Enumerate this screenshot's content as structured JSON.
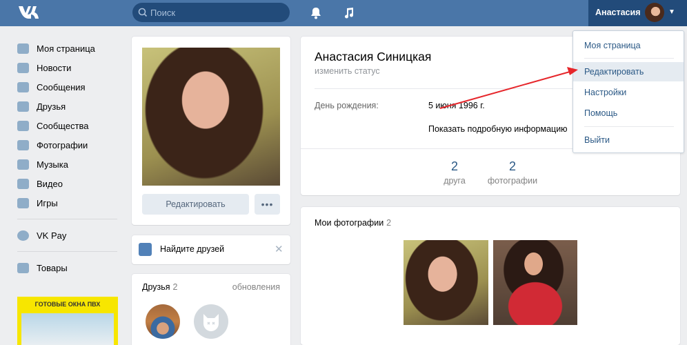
{
  "header": {
    "search_placeholder": "Поиск",
    "profile_name": "Анастасия"
  },
  "sidebar": {
    "items": [
      {
        "label": "Моя страница",
        "icon": "home-icon"
      },
      {
        "label": "Новости",
        "icon": "news-icon"
      },
      {
        "label": "Сообщения",
        "icon": "messages-icon"
      },
      {
        "label": "Друзья",
        "icon": "friends-icon"
      },
      {
        "label": "Сообщества",
        "icon": "groups-icon"
      },
      {
        "label": "Фотографии",
        "icon": "camera-icon"
      },
      {
        "label": "Музыка",
        "icon": "music-icon"
      },
      {
        "label": "Видео",
        "icon": "video-icon"
      },
      {
        "label": "Игры",
        "icon": "games-icon"
      }
    ],
    "vkpay": "VK Pay",
    "goods": "Товары",
    "ad_text": "ГОТОВЫЕ ОКНА ПВХ"
  },
  "profile_card": {
    "edit_label": "Редактировать",
    "more_label": "•••"
  },
  "find_friends": {
    "label": "Найдите друзей",
    "close": "✕"
  },
  "friends_block": {
    "title": "Друзья",
    "count": "2",
    "updates": "обновления"
  },
  "profile": {
    "name": "Анастасия Синицкая",
    "status_placeholder": "изменить статус",
    "birthday_label": "День рождения:",
    "birthday_value": "5 июня 1996 г.",
    "more_info": "Показать подробную информацию"
  },
  "stats": [
    {
      "num": "2",
      "label": "друга"
    },
    {
      "num": "2",
      "label": "фотографии"
    }
  ],
  "photos": {
    "title": "Мои фотографии",
    "count": "2"
  },
  "dropdown": {
    "items": [
      "Моя страница",
      "Редактировать",
      "Настройки",
      "Помощь",
      "Выйти"
    ]
  },
  "colors": {
    "header": "#4a76a8",
    "link": "#2a5885",
    "arrow": "#e6262b"
  }
}
